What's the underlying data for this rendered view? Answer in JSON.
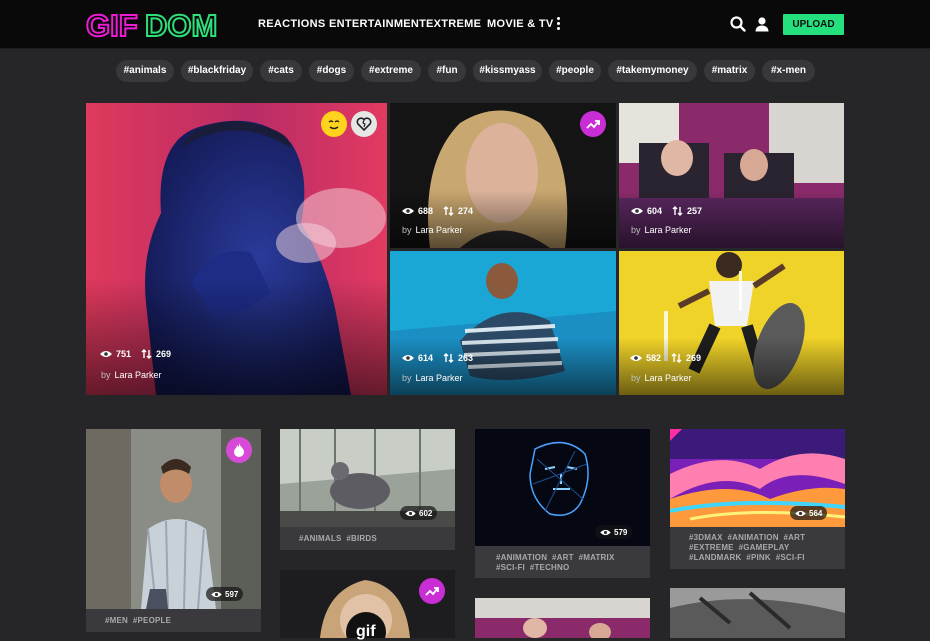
{
  "header": {
    "logo_text": "GIFDOM",
    "nav": [
      "REACTIONS",
      "ENTERTAINMENT",
      "EXTREME",
      "MOVIE & TV"
    ],
    "upload_label": "UPLOAD",
    "colors": {
      "logo_pink": "#ee1bd6",
      "logo_green": "#2ee07a",
      "upload_bg": "#24e07d"
    }
  },
  "tags": [
    "#animals",
    "#blackfriday",
    "#cats",
    "#dogs",
    "#extreme",
    "#fun",
    "#kissmyass",
    "#people",
    "#takemymoney",
    "#matrix",
    "#x-men"
  ],
  "featured": [
    {
      "views": "751",
      "shares": "269",
      "by_label": "by",
      "author": "Lara Parker",
      "badges": [
        "smiley-icon",
        "heart-broken-icon"
      ]
    },
    {
      "views": "688",
      "shares": "274",
      "by_label": "by",
      "author": "Lara Parker",
      "badges": [
        "trending-icon"
      ]
    },
    {
      "views": "604",
      "shares": "257",
      "by_label": "by",
      "author": "Lara Parker"
    },
    {
      "views": "614",
      "shares": "263",
      "by_label": "by",
      "author": "Lara Parker"
    },
    {
      "views": "582",
      "shares": "269",
      "by_label": "by",
      "author": "Lara Parker"
    }
  ],
  "cards": [
    {
      "views": "597",
      "tags_line1": "#MEN  #PEOPLE",
      "badge": "fire-icon"
    },
    {
      "views": "602",
      "tags_line1": "#ANIMALS  #BIRDS"
    },
    {
      "views": "579",
      "tags_line1": "#ANIMATION  #ART  #MATRIX",
      "tags_line2": "#SCI-FI  #TECHNO"
    },
    {
      "views": "564",
      "tags_line1": "#3DMAX  #ANIMATION  #ART",
      "tags_line2": "#EXTREME  #GAMEPLAY",
      "tags_line3": "#LANDMARK  #PINK  #SCI-FI"
    },
    {
      "overlay_text": "gif",
      "badge": "trending-icon"
    }
  ]
}
